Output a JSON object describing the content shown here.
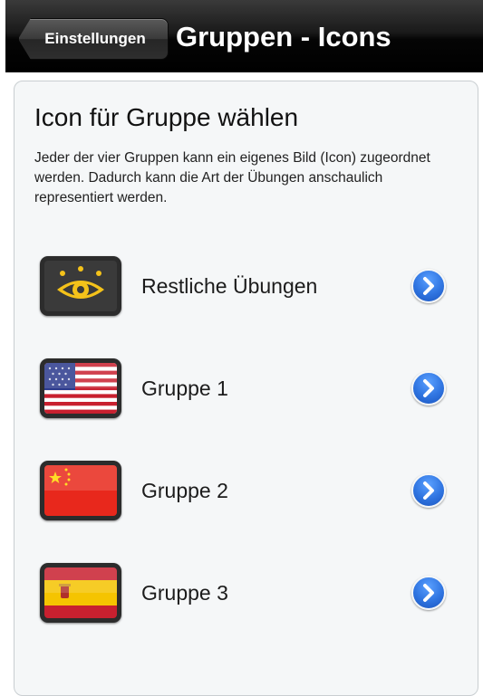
{
  "navbar": {
    "back_label": "Einstellungen",
    "title": "Gruppen - Icons"
  },
  "card": {
    "title": "Icon für Gruppe wählen",
    "description": "Jeder der vier Gruppen kann ein eigenes Bild (Icon) zugeordnet werden. Dadurch kann die Art der Übungen anschaulich representiert werden."
  },
  "groups": [
    {
      "label": "Restliche Übungen",
      "icon": "eye-icon"
    },
    {
      "label": "Gruppe 1",
      "icon": "usa-flag-icon"
    },
    {
      "label": "Gruppe 2",
      "icon": "china-flag-icon"
    },
    {
      "label": "Gruppe 3",
      "icon": "spain-flag-icon"
    }
  ],
  "colors": {
    "accent_blue": "#2f74e0",
    "navbar": "#000000",
    "card_background": "#f5f7f8"
  }
}
